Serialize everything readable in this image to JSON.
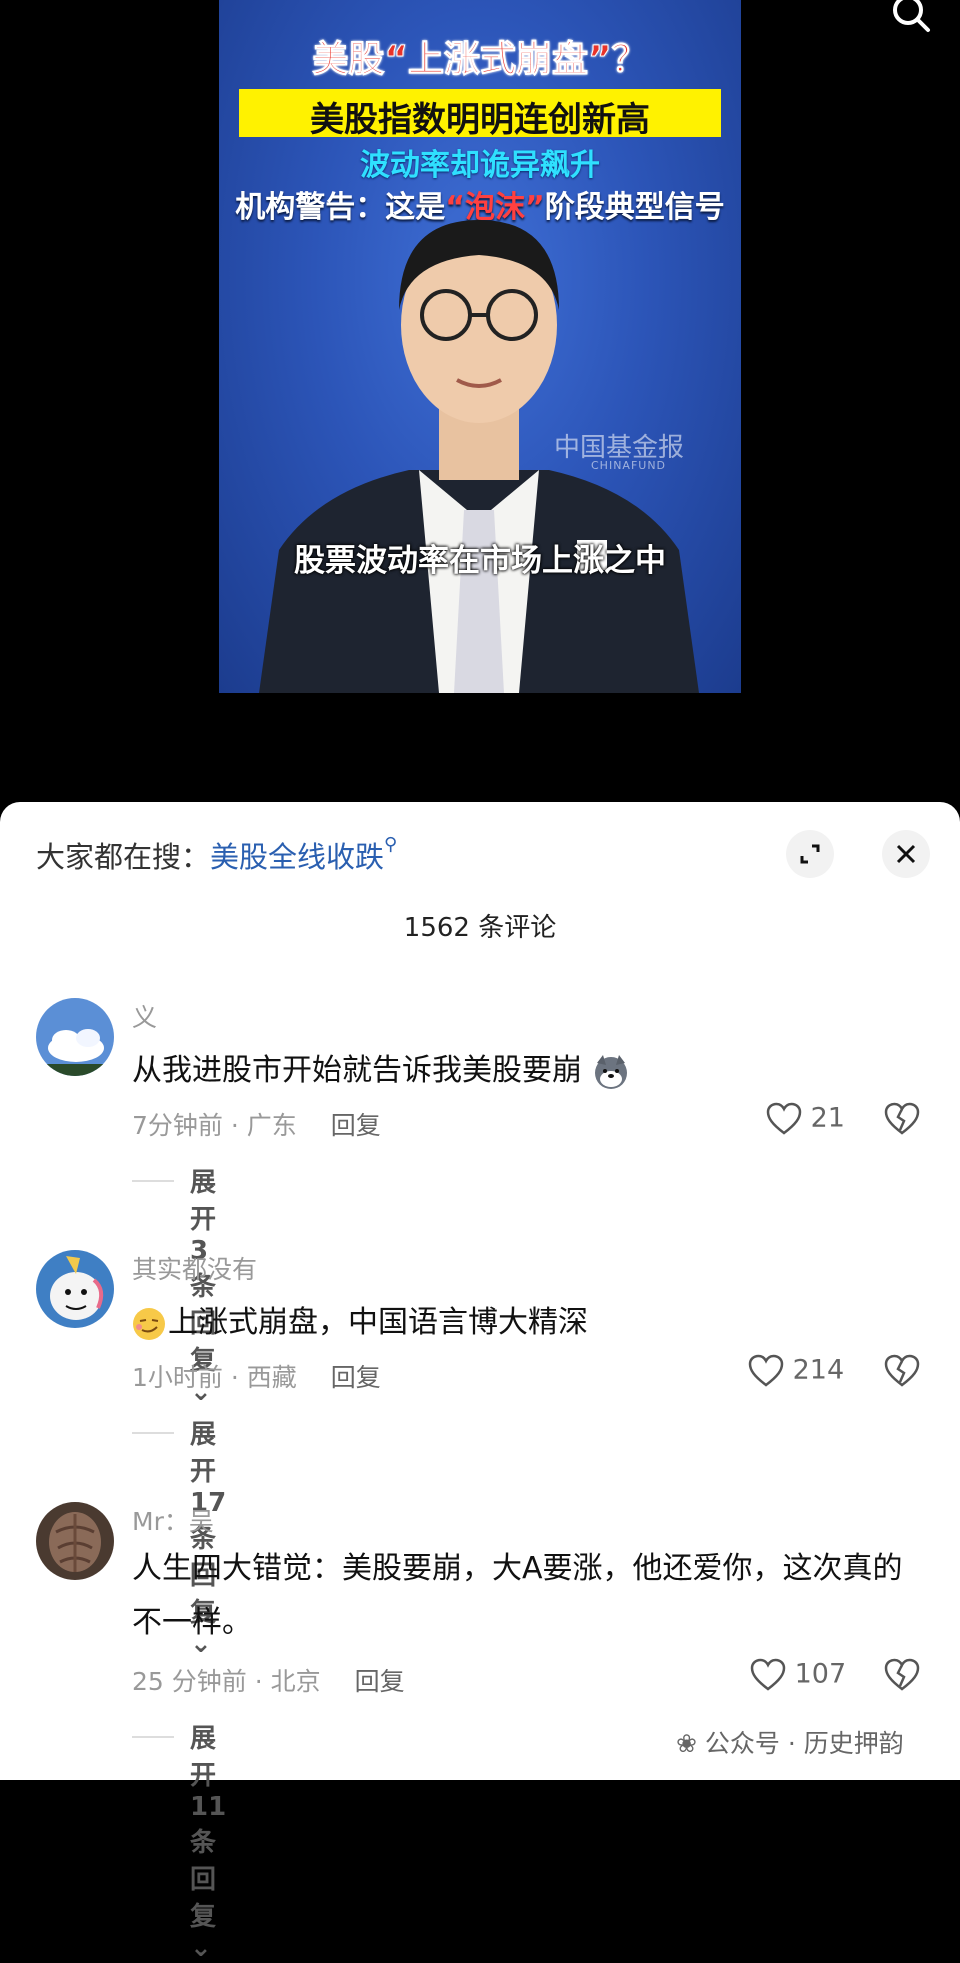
{
  "video": {
    "headline_1": "美股“上涨式崩盘”？",
    "headline_2": "美股指数明明连创新高",
    "headline_3": "波动率却诡异飙升",
    "headline_4_prefix": "机构警告：这是",
    "headline_4_highlight": "“泡沫”",
    "headline_4_suffix": "阶段典型信号",
    "watermark": "中国基金报",
    "watermark_sub": "CHINAFUND",
    "subtitle": "股票波动率在市场上涨之中",
    "search_icon": "search-icon"
  },
  "sheet": {
    "hot_search_label": "大家都在搜：",
    "hot_search_link": "美股全线收跌",
    "hot_search_icon": "search-icon",
    "expand_icon": "expand-icon",
    "close_icon": "close-icon",
    "comment_count": "1562 条评论"
  },
  "comments": [
    {
      "username": "义",
      "text": "从我进股市开始就告诉我美股要崩",
      "emoji": "husky-emoji",
      "time_location": "7分钟前 · 广东",
      "reply_label": "回复",
      "likes": "21",
      "expand_label": "展开 3 条回复"
    },
    {
      "username": "其实都没有",
      "text": "上涨式崩盘，中国语言博大精深",
      "emoji": "smirk-emoji",
      "time_location": "1小时前 · 西藏",
      "reply_label": "回复",
      "likes": "214",
      "expand_label": "展开 17 条回复"
    },
    {
      "username": "Mr：吴",
      "text": "人生四大错觉：美股要崩，大A要涨，他还爱你，这次真的不一样。",
      "time_location": "25 分钟前 · 北京",
      "reply_label": "回复",
      "likes": "107",
      "expand_label": "展开 11 条回复"
    }
  ],
  "footer": {
    "watermark": "公众号 · 历史押韵"
  }
}
